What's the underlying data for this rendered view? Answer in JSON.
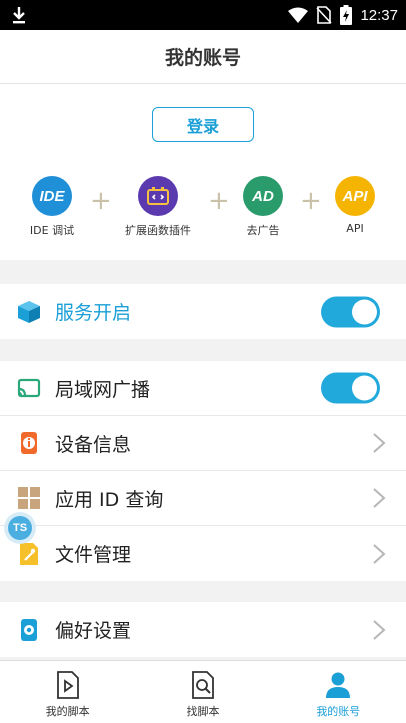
{
  "status_bar": {
    "time": "12:37"
  },
  "header": {
    "title": "我的账号"
  },
  "login": {
    "label": "登录"
  },
  "features": [
    {
      "label": "IDE 调试",
      "icon": "ide-icon",
      "badge": "IDE",
      "color": "#1f8fd8"
    },
    {
      "label": "扩展函数插件",
      "icon": "plugin-icon",
      "color": "#5b3ab0"
    },
    {
      "label": "去广告",
      "icon": "remove-ad-icon",
      "badge": "AD",
      "color": "#2a9c6c"
    },
    {
      "label": "API",
      "icon": "api-icon",
      "badge": "API",
      "color": "#f4b400"
    }
  ],
  "service": {
    "label": "服务开启",
    "enabled": true
  },
  "menu": {
    "lan_broadcast": {
      "label": "局域网广播",
      "enabled": true
    },
    "device_info": {
      "label": "设备信息"
    },
    "app_id_query": {
      "label": "应用 ID 查询"
    },
    "file_manager": {
      "label": "文件管理"
    },
    "preferences": {
      "label": "偏好设置"
    }
  },
  "float_badge": {
    "text": "TS"
  },
  "bottom_nav": [
    {
      "label": "我的脚本",
      "icon": "script-icon",
      "active": false
    },
    {
      "label": "找脚本",
      "icon": "find-script-icon",
      "active": false
    },
    {
      "label": "我的账号",
      "icon": "account-icon",
      "active": true
    }
  ],
  "colors": {
    "accent": "#1a9fd6",
    "toggle_on": "#21a9dc"
  }
}
